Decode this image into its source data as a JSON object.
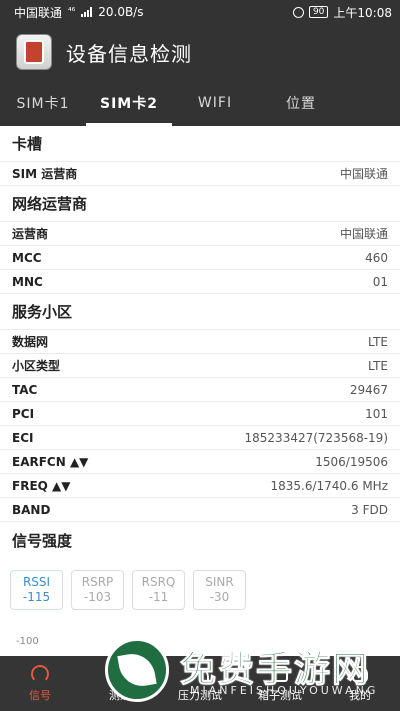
{
  "statusbar": {
    "carrier": "中国联通",
    "network_badge": "⁴⁶",
    "speed": "20.0B/s",
    "battery": "90",
    "time": "上午10:08"
  },
  "appbar": {
    "title": "设备信息检测"
  },
  "tabs": [
    {
      "label": "SIM卡1"
    },
    {
      "label": "SIM卡2",
      "active": true
    },
    {
      "label": "WIFI"
    },
    {
      "label": "位置"
    }
  ],
  "sections": {
    "slot": {
      "title": "卡槽",
      "rows": [
        {
          "label": "SIM 运营商",
          "value": "中国联通"
        }
      ]
    },
    "operator": {
      "title": "网络运营商",
      "rows": [
        {
          "label": "运营商",
          "value": "中国联通"
        },
        {
          "label": "MCC",
          "value": "460"
        },
        {
          "label": "MNC",
          "value": "01"
        }
      ]
    },
    "cell": {
      "title": "服务小区",
      "rows": [
        {
          "label": "数据网",
          "value": "LTE"
        },
        {
          "label": "小区类型",
          "value": "LTE"
        },
        {
          "label": "TAC",
          "value": "29467"
        },
        {
          "label": "PCI",
          "value": "101"
        },
        {
          "label": "ECI",
          "value": "185233427(723568-19)"
        },
        {
          "label": "EARFCN ▲▼",
          "value": "1506/19506"
        },
        {
          "label": "FREQ ▲▼",
          "value": "1835.6/1740.6 MHz"
        },
        {
          "label": "BAND",
          "value": "3 FDD"
        }
      ]
    },
    "signal": {
      "title": "信号强度",
      "chips": [
        {
          "name": "RSSI",
          "value": "-115",
          "active": true
        },
        {
          "name": "RSRP",
          "value": "-103"
        },
        {
          "name": "RSRQ",
          "value": "-11"
        },
        {
          "name": "SINR",
          "value": "-30"
        }
      ],
      "axis_label": "-100"
    }
  },
  "bottomnav": [
    {
      "label": "信号",
      "icon": "signal-icon",
      "active": true
    },
    {
      "label": "测速",
      "icon": "speed-icon"
    },
    {
      "label": "压力测试",
      "icon": "pressure-icon"
    },
    {
      "label": "箱子测试",
      "icon": "box-icon"
    },
    {
      "label": "我的",
      "icon": "profile-icon"
    }
  ],
  "watermark": {
    "text": "免费手游网",
    "sub": "MIANFEISHOUYOUWANG"
  },
  "colors": {
    "bar": "#333333",
    "accent": "#e2583e",
    "chip_active": "#3b8ec9"
  }
}
